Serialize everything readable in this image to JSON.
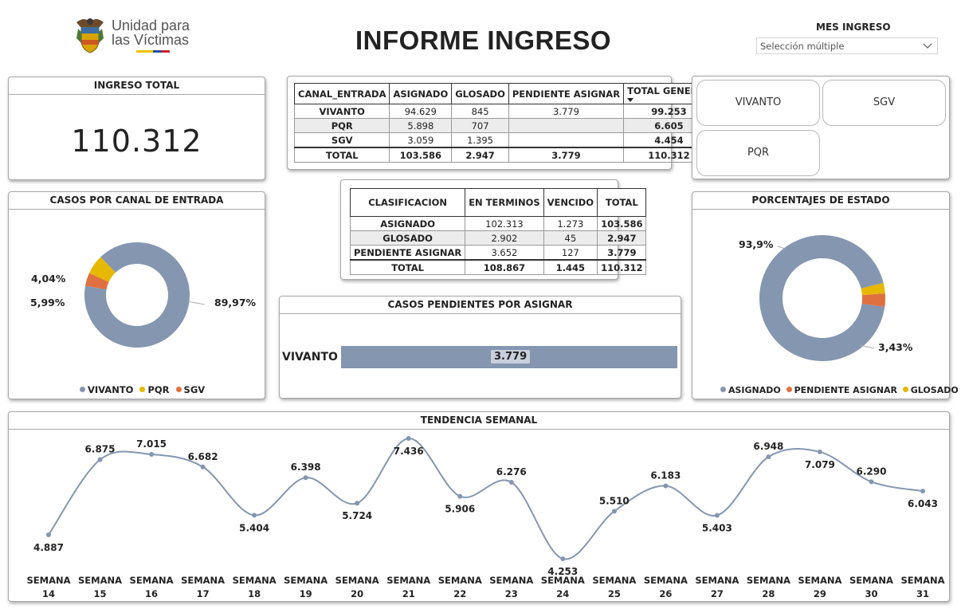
{
  "header": {
    "logo_line1": "Unidad para",
    "logo_line2": "las Víctimas",
    "title": "INFORME INGRESO",
    "filter_label": "MES INGRESO",
    "filter_value": "Selección múltiple"
  },
  "ingreso_total": {
    "title": "INGRESO TOTAL",
    "value": "110.312"
  },
  "canal_table": {
    "headers": [
      "CANAL_ENTRADA",
      "ASIGNADO",
      "GLOSADO",
      "PENDIENTE ASIGNAR",
      "TOTAL GENERAL"
    ],
    "rows": [
      [
        "VIVANTO",
        "94.629",
        "845",
        "3.779",
        "99.253"
      ],
      [
        "PQR",
        "5.898",
        "707",
        "",
        "6.605"
      ],
      [
        "SGV",
        "3.059",
        "1.395",
        "",
        "4.454"
      ]
    ],
    "total": [
      "TOTAL",
      "103.586",
      "2.947",
      "3.779",
      "110.312"
    ]
  },
  "clasif_table": {
    "headers": [
      "CLASIFICACION",
      "EN TERMINOS",
      "VENCIDO",
      "TOTAL"
    ],
    "rows": [
      [
        "ASIGNADO",
        "102.313",
        "1.273",
        "103.586"
      ],
      [
        "GLOSADO",
        "2.902",
        "45",
        "2.947"
      ],
      [
        "PENDIENTE ASIGNAR",
        "3.652",
        "127",
        "3.779"
      ]
    ],
    "total": [
      "TOTAL",
      "108.867",
      "1.445",
      "110.312"
    ]
  },
  "slicer": {
    "buttons": [
      "VIVANTO",
      "SGV",
      "PQR"
    ]
  },
  "colors": {
    "blue_gray": "#8496b0",
    "orange": "#e07040",
    "yellow": "#e6b800",
    "line": "#8496b0"
  },
  "chart_data": [
    {
      "type": "pie",
      "title": "CASOS POR CANAL DE ENTRADA",
      "categories": [
        "VIVANTO",
        "PQR",
        "SGV"
      ],
      "values": [
        89.97,
        5.99,
        4.04
      ],
      "labels": [
        "89,97%",
        "5,99%",
        "4,04%"
      ],
      "colors": [
        "#8496b0",
        "#e6b800",
        "#e07040"
      ],
      "donut": true,
      "legend": "bottom"
    },
    {
      "type": "pie",
      "title": "PORCENTAJES DE ESTADO",
      "categories": [
        "ASIGNADO",
        "PENDIENTE ASIGNAR",
        "GLOSADO"
      ],
      "values": [
        93.9,
        3.43,
        2.67
      ],
      "labels": [
        "93,9%",
        "3,43%",
        ""
      ],
      "colors": [
        "#8496b0",
        "#e07040",
        "#e6b800"
      ],
      "donut": true,
      "legend": "bottom"
    },
    {
      "type": "bar",
      "title": "CASOS PENDIENTES POR ASIGNAR",
      "categories": [
        "VIVANTO"
      ],
      "values": [
        3779
      ],
      "labels": [
        "3.779"
      ]
    },
    {
      "type": "line",
      "title": "TENDENCIA SEMANAL",
      "x": [
        "SEMANA 14",
        "SEMANA 15",
        "SEMANA 16",
        "SEMANA 17",
        "SEMANA 18",
        "SEMANA 19",
        "SEMANA 20",
        "SEMANA 21",
        "SEMANA 22",
        "SEMANA 23",
        "SEMANA 24",
        "SEMANA 25",
        "SEMANA 26",
        "SEMANA 27",
        "SEMANA 28",
        "SEMANA 29",
        "SEMANA 30",
        "SEMANA 31"
      ],
      "x_line1": [
        "SEMANA",
        "SEMANA",
        "SEMANA",
        "SEMANA",
        "SEMANA",
        "SEMANA",
        "SEMANA",
        "SEMANA",
        "SEMANA",
        "SEMANA",
        "SEMANA",
        "SEMANA",
        "SEMANA",
        "SEMANA",
        "SEMANA",
        "SEMANA",
        "SEMANA",
        "SEMANA"
      ],
      "x_line2": [
        "14",
        "15",
        "16",
        "17",
        "18",
        "19",
        "20",
        "21",
        "22",
        "23",
        "24",
        "25",
        "26",
        "27",
        "28",
        "29",
        "30",
        "31"
      ],
      "values": [
        4887,
        6875,
        7015,
        6682,
        5404,
        6398,
        5724,
        7436,
        5906,
        6276,
        4253,
        5510,
        6183,
        5403,
        6948,
        7079,
        6290,
        6043
      ],
      "labels": [
        "4.887",
        "6.875",
        "7.015",
        "6.682",
        "5.404",
        "6.398",
        "5.724",
        "7.436",
        "5.906",
        "6.276",
        "4.253",
        "5.510",
        "6.183",
        "5.403",
        "6.948",
        "7.079",
        "6.290",
        "6.043"
      ],
      "label_pos": [
        "below",
        "above",
        "above",
        "above",
        "below",
        "above",
        "below",
        "below",
        "below",
        "above",
        "below",
        "above",
        "above",
        "below",
        "above",
        "below",
        "above",
        "below"
      ]
    }
  ]
}
